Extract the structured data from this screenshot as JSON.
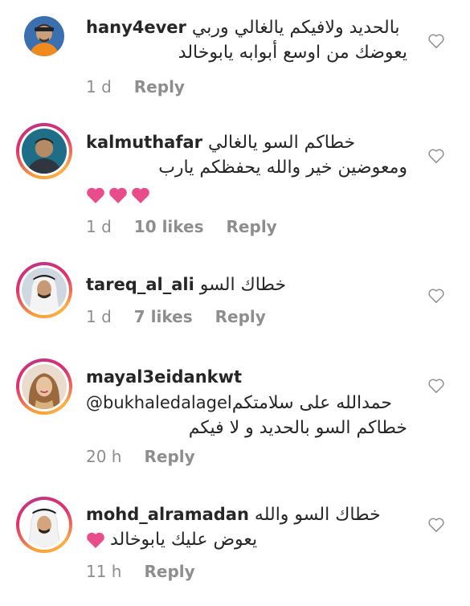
{
  "comments": [
    {
      "username": "hany4ever",
      "text": "بالحديد ولافيكم يالغالي وربي",
      "text2": "يعوضك من اوسع أبوابه يابوخالد",
      "time": "1 d",
      "likes": "",
      "reply": "Reply",
      "story_ring": false,
      "avatar_icon": "avatar-man-cap"
    },
    {
      "username": "kalmuthafar",
      "text": "خطاكم السو يالغالي",
      "text2": "ومعوضين خير والله يحفظكم يارب",
      "hearts": 3,
      "heart_color": "#e84c8b",
      "time": "1 d",
      "likes": "10 likes",
      "reply": "Reply",
      "story_ring": true,
      "avatar_icon": "avatar-man"
    },
    {
      "username": "tareq_al_ali",
      "text": "خطاك السو",
      "time": "1 d",
      "likes": "7 likes",
      "reply": "Reply",
      "story_ring": true,
      "avatar_icon": "avatar-man-ghutra"
    },
    {
      "username": "mayal3eidankwt",
      "mention": "@bukhaledalagel",
      "text": "حمدالله على سلامتكم",
      "text2": "خطاكم السو بالحديد و لا فيكم",
      "time": "20 h",
      "likes": "",
      "reply": "Reply",
      "story_ring": true,
      "avatar_icon": "avatar-woman"
    },
    {
      "username": "mohd_alramadan",
      "text": "خطاك السو والله",
      "text2": "يعوض عليك يابوخالد",
      "heart_inline": true,
      "heart_color": "#e84c8b",
      "time": "11 h",
      "likes": "",
      "reply": "Reply",
      "story_ring": true,
      "avatar_icon": "avatar-man-ghutra"
    }
  ],
  "colors": {
    "text": "#262626",
    "meta": "#8e8e8e",
    "heart": "#e84c8b"
  }
}
